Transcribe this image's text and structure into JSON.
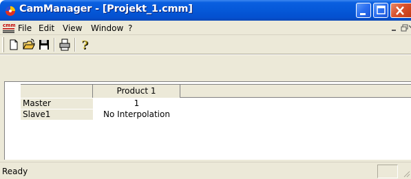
{
  "window": {
    "title": "CamManager - [Projekt_1.cmm]",
    "app_icon": "cammanager-app-icon",
    "controls": [
      "minimize-icon",
      "maximize-icon",
      "close-icon"
    ]
  },
  "menubar": {
    "doc_icon": "cmm-document-icon",
    "items": [
      "File",
      "Edit",
      "View",
      "Window",
      "?"
    ],
    "mdi_controls": [
      "_",
      "̅❐",
      "×"
    ]
  },
  "toolbar": {
    "buttons": [
      "new-file-icon",
      "open-folder-icon",
      "save-disk-icon",
      "print-icon",
      "help-icon"
    ]
  },
  "grid": {
    "columns": [
      "Product 1"
    ],
    "rows": [
      {
        "label": "Master",
        "value": "1"
      },
      {
        "label": "Slave1",
        "value": "No Interpolation"
      }
    ]
  },
  "statusbar": {
    "text": "Ready"
  },
  "colors": {
    "titlebar": "#0558d8",
    "chrome": "#ece9d8",
    "close_button": "#d8522e"
  }
}
